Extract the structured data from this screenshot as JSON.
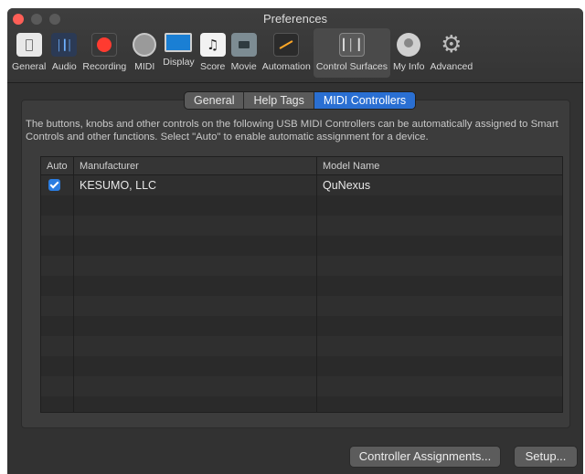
{
  "window": {
    "title": "Preferences"
  },
  "toolbar": {
    "items": [
      {
        "label": "General",
        "icon": "general-icon"
      },
      {
        "label": "Audio",
        "icon": "audio-icon"
      },
      {
        "label": "Recording",
        "icon": "recording-icon"
      },
      {
        "label": "MIDI",
        "icon": "midi-icon"
      },
      {
        "label": "Display",
        "icon": "display-icon"
      },
      {
        "label": "Score",
        "icon": "score-icon"
      },
      {
        "label": "Movie",
        "icon": "movie-icon"
      },
      {
        "label": "Automation",
        "icon": "automation-icon"
      },
      {
        "label": "Control Surfaces",
        "icon": "control-surfaces-icon",
        "active": true
      },
      {
        "label": "My Info",
        "icon": "my-info-icon"
      },
      {
        "label": "Advanced",
        "icon": "advanced-icon"
      }
    ]
  },
  "tabs": {
    "general": "General",
    "help_tags": "Help Tags",
    "midi_controllers": "MIDI Controllers",
    "selected": "MIDI Controllers"
  },
  "description": "The buttons, knobs and other controls on the following USB MIDI Controllers can be automatically assigned to Smart Controls and other functions. Select \"Auto\" to enable automatic assignment for a device.",
  "table": {
    "headers": {
      "auto": "Auto",
      "manufacturer": "Manufacturer",
      "model": "Model Name"
    },
    "rows": [
      {
        "auto": true,
        "manufacturer": "KESUMO, LLC",
        "model": "QuNexus"
      }
    ]
  },
  "buttons": {
    "controller_assignments": "Controller Assignments...",
    "setup": "Setup..."
  },
  "colors": {
    "accent": "#2a6fd2",
    "close_button": "#ff5f57",
    "window_bg": "#323232"
  }
}
